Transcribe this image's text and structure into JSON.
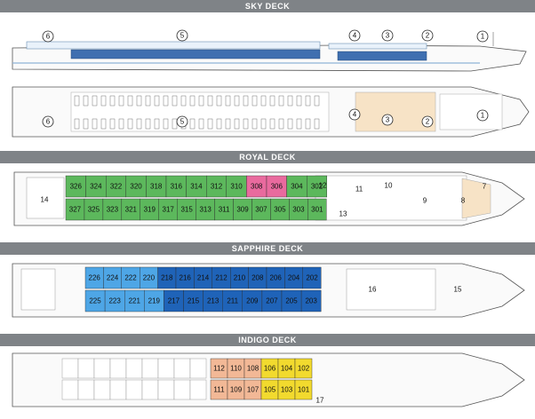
{
  "decks": {
    "sky": {
      "title": "SKY DECK",
      "markers": [
        "1",
        "2",
        "3",
        "4",
        "5",
        "6"
      ]
    },
    "royal": {
      "title": "ROYAL DECK",
      "top_rooms": [
        "326",
        "324",
        "322",
        "320",
        "318",
        "316",
        "314",
        "312",
        "310",
        "308",
        "306",
        "304",
        "302"
      ],
      "bottom_rooms": [
        "327",
        "325",
        "323",
        "321",
        "319",
        "317",
        "315",
        "313",
        "311",
        "309",
        "307",
        "305",
        "303",
        "301"
      ],
      "labels": [
        "14",
        "12",
        "11",
        "10",
        "9",
        "8",
        "7",
        "13"
      ]
    },
    "sapphire": {
      "title": "SAPPHIRE DECK",
      "top_rooms": [
        "226",
        "224",
        "222",
        "220",
        "218",
        "216",
        "214",
        "212",
        "210",
        "208",
        "206",
        "204",
        "202"
      ],
      "bottom_rooms": [
        "225",
        "223",
        "221",
        "219",
        "217",
        "215",
        "213",
        "211",
        "209",
        "207",
        "205",
        "203"
      ],
      "labels": [
        "16",
        "15"
      ]
    },
    "indigo": {
      "title": "INDIGO DECK",
      "top_rooms": [
        "112",
        "110",
        "108",
        "106",
        "104",
        "102"
      ],
      "bottom_rooms": [
        "111",
        "109",
        "107",
        "105",
        "103",
        "101"
      ],
      "labels": [
        "17"
      ]
    }
  },
  "colors": {
    "band": "#7f8387",
    "green": "#5cb85c",
    "pink": "#e96a9e",
    "light_blue": "#4ea6e6",
    "dark_blue": "#1f63b8",
    "peach": "#f2b896",
    "yellow": "#f2da2e",
    "hull_bg": "#fafafa"
  }
}
